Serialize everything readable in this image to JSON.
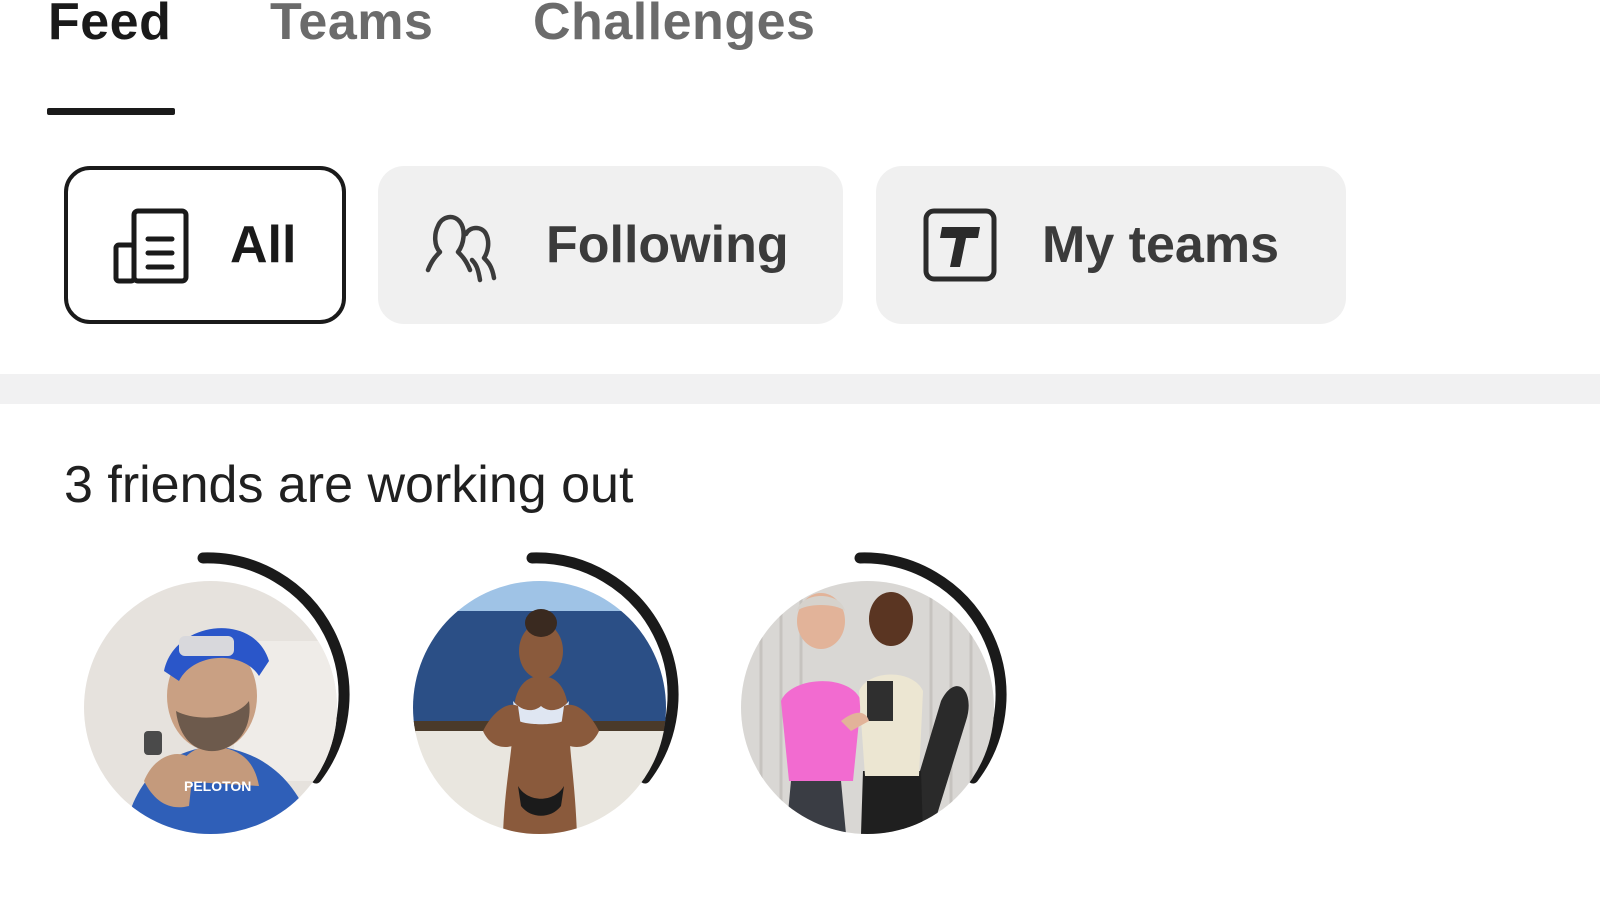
{
  "tabs": [
    {
      "label": "Feed",
      "active": true
    },
    {
      "label": "Teams",
      "active": false
    },
    {
      "label": "Challenges",
      "active": false
    }
  ],
  "filters": [
    {
      "label": "All",
      "icon": "feed-document-icon",
      "active": true
    },
    {
      "label": "Following",
      "icon": "people-icon",
      "active": false
    },
    {
      "label": "My teams",
      "icon": "team-badge-icon",
      "active": false
    }
  ],
  "friends_section": {
    "title": "3 friends are working out",
    "avatars": [
      {
        "name": "friend-avatar-1",
        "ring_progress": 0.28,
        "shirt_text": "PELOTON"
      },
      {
        "name": "friend-avatar-2",
        "ring_progress": 0.28
      },
      {
        "name": "friend-avatar-3",
        "ring_progress": 0.28
      }
    ]
  },
  "colors": {
    "text_primary": "#1a1a1a",
    "text_muted": "#6b6b6b",
    "chip_bg": "#f0f0f0",
    "divider": "#f1f1f2",
    "ring": "#1a1a1a"
  }
}
